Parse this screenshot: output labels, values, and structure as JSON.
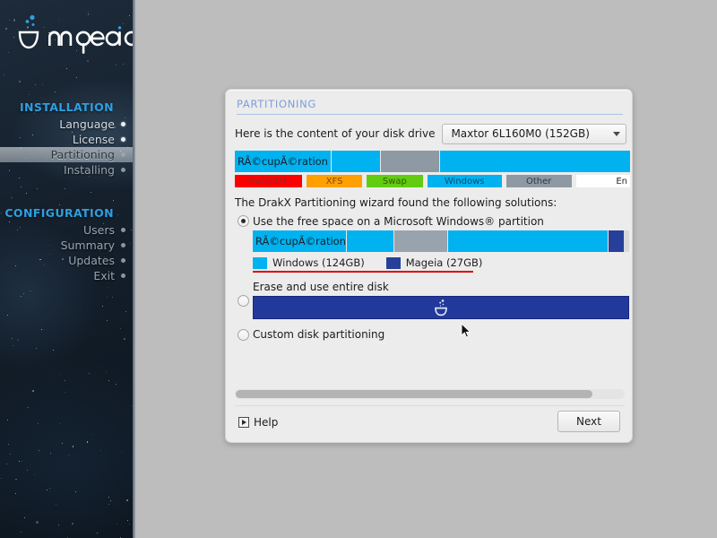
{
  "sidebar": {
    "logo_text": "mageia",
    "sections": [
      {
        "heading": "INSTALLATION",
        "items": [
          {
            "label": "Language",
            "state": "done"
          },
          {
            "label": "License",
            "state": "done"
          },
          {
            "label": "Partitioning",
            "state": "active"
          },
          {
            "label": "Installing",
            "state": "pending"
          }
        ]
      },
      {
        "heading": "CONFIGURATION",
        "items": [
          {
            "label": "Users",
            "state": "pending"
          },
          {
            "label": "Summary",
            "state": "pending"
          },
          {
            "label": "Updates",
            "state": "pending"
          },
          {
            "label": "Exit",
            "state": "pending"
          }
        ]
      }
    ]
  },
  "dialog": {
    "title": "PARTITIONING",
    "drive": {
      "label": "Here is the content of your disk drive",
      "selected": "Maxtor 6L160M0 (152GB)",
      "caret_icon": "chevron-down-icon"
    },
    "disk_overview": {
      "segments": [
        {
          "label": "RÃ©cupÃ©ration",
          "type": "Windows",
          "color": "#00b2f0",
          "width_pct": 24.5
        },
        {
          "label": "",
          "type": "Windows",
          "color": "#00b2f0",
          "width_pct": 12.5
        },
        {
          "label": "",
          "type": "Other",
          "color": "#8e99a3",
          "width_pct": 15.0
        },
        {
          "label": "",
          "type": "Windows",
          "color": "#00b2f0",
          "width_pct": 48.0
        }
      ]
    },
    "legend": [
      {
        "label": "Ext2/3/4",
        "color": "#fc0000",
        "text_color": "#8b2b2b",
        "width_pct": 18.0
      },
      {
        "label": "XFS",
        "color": "#ffa000",
        "text_color": "#7a4b00",
        "width_pct": 15.0
      },
      {
        "label": "Swap",
        "color": "#62cc11",
        "text_color": "#2e5a08",
        "width_pct": 15.0
      },
      {
        "label": "Windows",
        "color": "#00b2f0",
        "text_color": "#0d4e6b",
        "width_pct": 20.0
      },
      {
        "label": "Other",
        "color": "#8e99a3",
        "text_color": "#2e3942",
        "width_pct": 17.5
      },
      {
        "label": "En",
        "color": "#ffffff",
        "text_color": "#2b2b2b",
        "width_pct": 14.5
      }
    ],
    "wizard_text": "The DrakX Partitioning wizard found the following solutions:",
    "options": [
      {
        "id": "use-free-space",
        "title": "Use the free space on a Microsoft Windows® partition",
        "selected": true
      },
      {
        "id": "erase-entire-disk",
        "title": "Erase and use entire disk",
        "selected": false
      },
      {
        "id": "custom-disk-partitioning",
        "title": "Custom disk partitioning",
        "selected": false
      }
    ],
    "proposal_bar": {
      "segments": [
        {
          "label": "RÃ©cupÃ©ration",
          "color": "#00b2f0",
          "width_pct": 25.0
        },
        {
          "label": "",
          "color": "#00b2f0",
          "width_pct": 12.5
        },
        {
          "label": "",
          "color": "#99a3ad",
          "width_pct": 14.5
        },
        {
          "label": "",
          "color": "#00b2f0",
          "width_pct": 42.5
        },
        {
          "label": "",
          "color": "#26409a",
          "width_pct": 4.0
        }
      ],
      "legend": [
        {
          "label": "Windows (124GB)",
          "color": "#00b2f0"
        },
        {
          "label": "Mageia (27GB)",
          "color": "#26409a"
        }
      ],
      "underline_color": "#e00000"
    },
    "erase_bar": {
      "color": "#22399c",
      "icon": "mageia-logo-icon"
    },
    "footer": {
      "help_label": "Help",
      "help_icon": "play-in-box-icon",
      "next_label": "Next"
    },
    "scrollbar": {
      "thumb_pct": 92
    }
  }
}
